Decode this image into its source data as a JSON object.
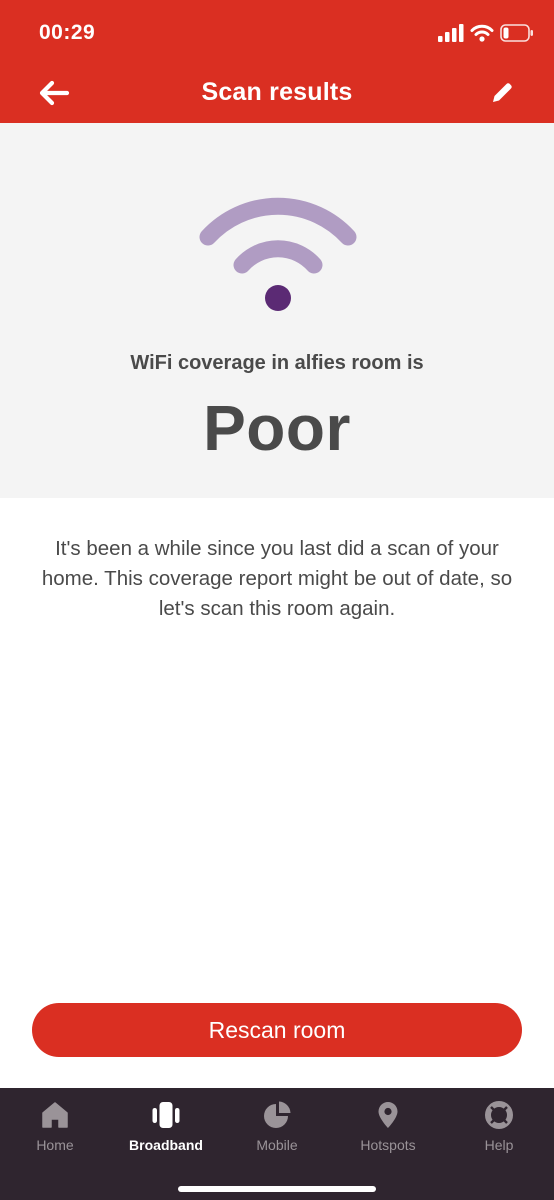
{
  "status_bar": {
    "time": "00:29"
  },
  "header": {
    "title": "Scan results",
    "back_icon": "arrow-left-icon",
    "edit_icon": "pencil-icon"
  },
  "hero": {
    "coverage_text": "WiFi coverage in alfies room is",
    "rating": "Poor",
    "signal_icon": "wifi-signal-icon"
  },
  "message": "It's been a while since you last did a scan of your home. This coverage report might be out of date, so let's scan this room again.",
  "actions": {
    "rescan_label": "Rescan room"
  },
  "tabbar": {
    "items": [
      {
        "label": "Home",
        "icon": "house-icon"
      },
      {
        "label": "Broadband",
        "icon": "router-icon",
        "active": true
      },
      {
        "label": "Mobile",
        "icon": "pie-chart-icon"
      },
      {
        "label": "Hotspots",
        "icon": "map-pin-icon"
      },
      {
        "label": "Help",
        "icon": "lifebuoy-icon"
      }
    ]
  },
  "colors": {
    "brand_red": "#da2f22",
    "hero_background": "#f4f4f4",
    "text_dark": "#4a4a4a",
    "wifi_arc": "#b09cc3",
    "wifi_dot": "#5b2a74",
    "tabbar_background": "#2f252f",
    "tab_inactive": "#9a9398"
  }
}
